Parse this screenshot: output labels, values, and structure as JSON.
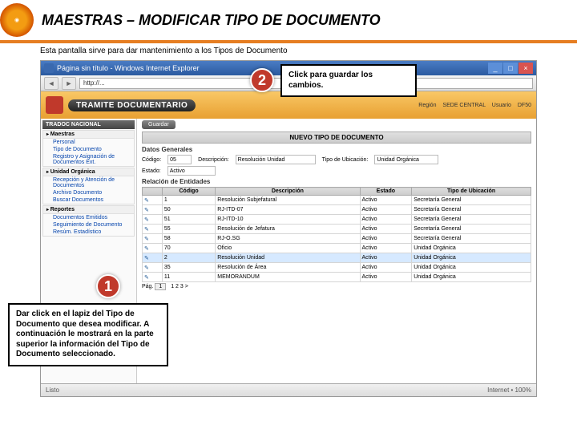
{
  "slide": {
    "title": "MAESTRAS – MODIFICAR TIPO DE DOCUMENTO",
    "subtitle": "Esta pantalla sirve para dar mantenimiento a los Tipos de Documento"
  },
  "browser": {
    "title": "Página sin título - Windows Internet Explorer",
    "address": "http://...",
    "minimize": "_",
    "maximize": "□",
    "close": "×",
    "back": "◄",
    "forward": "►",
    "status_left": "Listo",
    "status_right": "Internet • 100%"
  },
  "app": {
    "name": "TRAMITE DOCUMENTARIO",
    "region_label": "Región",
    "region_value": "SEDE CENTRAL",
    "user_label": "Usuario",
    "user_value": "DF50"
  },
  "sidebar": {
    "header": "TRADOC NACIONAL",
    "groups": [
      {
        "title": "Maestras",
        "items": [
          "Personal",
          "Tipo de Documento",
          "Registro y Asignación de Documentos Ext."
        ]
      },
      {
        "title": "Unidad Orgánica",
        "items": [
          "Recepción y Atención de Documentos",
          "Archivo Documento",
          "Buscar Documentos"
        ]
      },
      {
        "title": "Reportes",
        "items": [
          "Documentos Emitidos",
          "Seguimiento de Documento",
          "Resúm. Estadístico"
        ]
      }
    ]
  },
  "main": {
    "save_label": "Guardar",
    "panel_title": "NUEVO TIPO DE DOCUMENTO",
    "section_general": "Datos Generales",
    "form": {
      "codigo_label": "Código",
      "codigo_value": "05",
      "desc_label": "Descripción",
      "desc_value": "Resolución Unidad",
      "tipo_label": "Tipo de Ubicación",
      "tipo_value": "Unidad Orgánica",
      "estado_label": "Estado",
      "estado_value": "Activo"
    },
    "section_rel": "Relación de Entidades",
    "cols": {
      "c0": "",
      "c1": "Código",
      "c2": "Descripción",
      "c3": "Estado",
      "c4": "Tipo de Ubicación"
    },
    "rows": [
      {
        "codigo": "1",
        "desc": "Resolución Subjefatural",
        "estado": "Activo",
        "ubi": "Secretaría General"
      },
      {
        "codigo": "50",
        "desc": "RJ-ITD-07",
        "estado": "Activo",
        "ubi": "Secretaría General"
      },
      {
        "codigo": "51",
        "desc": "RJ-ITD-10",
        "estado": "Activo",
        "ubi": "Secretaría General"
      },
      {
        "codigo": "55",
        "desc": "Resolución de Jefatura",
        "estado": "Activo",
        "ubi": "Secretaría General"
      },
      {
        "codigo": "58",
        "desc": "RJ-O.SG",
        "estado": "Activo",
        "ubi": "Secretaría General"
      },
      {
        "codigo": "70",
        "desc": "Oficio",
        "estado": "Activo",
        "ubi": "Unidad Orgánica"
      },
      {
        "codigo": "2",
        "desc": "Resolución Unidad",
        "estado": "Activo",
        "ubi": "Unidad Orgánica",
        "selected": true
      },
      {
        "codigo": "35",
        "desc": "Resolución de Área",
        "estado": "Activo",
        "ubi": "Unidad Orgánica"
      },
      {
        "codigo": "11",
        "desc": "MEMORANDUM",
        "estado": "Activo",
        "ubi": "Unidad Orgánica"
      }
    ],
    "pager_label": "Pág.",
    "pager_value": "1",
    "pager_sep": "1 2 3 >"
  },
  "callouts": {
    "num1": "1",
    "num2": "2",
    "box1": "Dar click en el lapiz del Tipo de Documento que desea modificar. A continuación le mostrará en la parte superior la información del Tipo de Documento seleccionado.",
    "box2": "Click para guardar los cambios."
  }
}
